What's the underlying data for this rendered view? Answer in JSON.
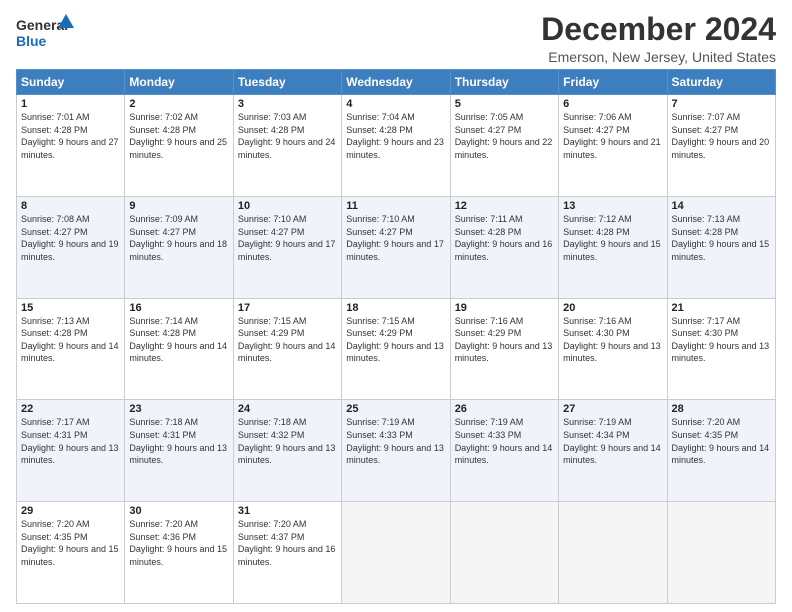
{
  "logo": {
    "line1": "General",
    "line2": "Blue"
  },
  "title": "December 2024",
  "subtitle": "Emerson, New Jersey, United States",
  "days_header": [
    "Sunday",
    "Monday",
    "Tuesday",
    "Wednesday",
    "Thursday",
    "Friday",
    "Saturday"
  ],
  "weeks": [
    [
      {
        "day": "1",
        "sunrise": "7:01 AM",
        "sunset": "4:28 PM",
        "daylight": "9 hours and 27 minutes."
      },
      {
        "day": "2",
        "sunrise": "7:02 AM",
        "sunset": "4:28 PM",
        "daylight": "9 hours and 25 minutes."
      },
      {
        "day": "3",
        "sunrise": "7:03 AM",
        "sunset": "4:28 PM",
        "daylight": "9 hours and 24 minutes."
      },
      {
        "day": "4",
        "sunrise": "7:04 AM",
        "sunset": "4:28 PM",
        "daylight": "9 hours and 23 minutes."
      },
      {
        "day": "5",
        "sunrise": "7:05 AM",
        "sunset": "4:27 PM",
        "daylight": "9 hours and 22 minutes."
      },
      {
        "day": "6",
        "sunrise": "7:06 AM",
        "sunset": "4:27 PM",
        "daylight": "9 hours and 21 minutes."
      },
      {
        "day": "7",
        "sunrise": "7:07 AM",
        "sunset": "4:27 PM",
        "daylight": "9 hours and 20 minutes."
      }
    ],
    [
      {
        "day": "8",
        "sunrise": "7:08 AM",
        "sunset": "4:27 PM",
        "daylight": "9 hours and 19 minutes."
      },
      {
        "day": "9",
        "sunrise": "7:09 AM",
        "sunset": "4:27 PM",
        "daylight": "9 hours and 18 minutes."
      },
      {
        "day": "10",
        "sunrise": "7:10 AM",
        "sunset": "4:27 PM",
        "daylight": "9 hours and 17 minutes."
      },
      {
        "day": "11",
        "sunrise": "7:10 AM",
        "sunset": "4:27 PM",
        "daylight": "9 hours and 17 minutes."
      },
      {
        "day": "12",
        "sunrise": "7:11 AM",
        "sunset": "4:28 PM",
        "daylight": "9 hours and 16 minutes."
      },
      {
        "day": "13",
        "sunrise": "7:12 AM",
        "sunset": "4:28 PM",
        "daylight": "9 hours and 15 minutes."
      },
      {
        "day": "14",
        "sunrise": "7:13 AM",
        "sunset": "4:28 PM",
        "daylight": "9 hours and 15 minutes."
      }
    ],
    [
      {
        "day": "15",
        "sunrise": "7:13 AM",
        "sunset": "4:28 PM",
        "daylight": "9 hours and 14 minutes."
      },
      {
        "day": "16",
        "sunrise": "7:14 AM",
        "sunset": "4:28 PM",
        "daylight": "9 hours and 14 minutes."
      },
      {
        "day": "17",
        "sunrise": "7:15 AM",
        "sunset": "4:29 PM",
        "daylight": "9 hours and 14 minutes."
      },
      {
        "day": "18",
        "sunrise": "7:15 AM",
        "sunset": "4:29 PM",
        "daylight": "9 hours and 13 minutes."
      },
      {
        "day": "19",
        "sunrise": "7:16 AM",
        "sunset": "4:29 PM",
        "daylight": "9 hours and 13 minutes."
      },
      {
        "day": "20",
        "sunrise": "7:16 AM",
        "sunset": "4:30 PM",
        "daylight": "9 hours and 13 minutes."
      },
      {
        "day": "21",
        "sunrise": "7:17 AM",
        "sunset": "4:30 PM",
        "daylight": "9 hours and 13 minutes."
      }
    ],
    [
      {
        "day": "22",
        "sunrise": "7:17 AM",
        "sunset": "4:31 PM",
        "daylight": "9 hours and 13 minutes."
      },
      {
        "day": "23",
        "sunrise": "7:18 AM",
        "sunset": "4:31 PM",
        "daylight": "9 hours and 13 minutes."
      },
      {
        "day": "24",
        "sunrise": "7:18 AM",
        "sunset": "4:32 PM",
        "daylight": "9 hours and 13 minutes."
      },
      {
        "day": "25",
        "sunrise": "7:19 AM",
        "sunset": "4:33 PM",
        "daylight": "9 hours and 13 minutes."
      },
      {
        "day": "26",
        "sunrise": "7:19 AM",
        "sunset": "4:33 PM",
        "daylight": "9 hours and 14 minutes."
      },
      {
        "day": "27",
        "sunrise": "7:19 AM",
        "sunset": "4:34 PM",
        "daylight": "9 hours and 14 minutes."
      },
      {
        "day": "28",
        "sunrise": "7:20 AM",
        "sunset": "4:35 PM",
        "daylight": "9 hours and 14 minutes."
      }
    ],
    [
      {
        "day": "29",
        "sunrise": "7:20 AM",
        "sunset": "4:35 PM",
        "daylight": "9 hours and 15 minutes."
      },
      {
        "day": "30",
        "sunrise": "7:20 AM",
        "sunset": "4:36 PM",
        "daylight": "9 hours and 15 minutes."
      },
      {
        "day": "31",
        "sunrise": "7:20 AM",
        "sunset": "4:37 PM",
        "daylight": "9 hours and 16 minutes."
      },
      null,
      null,
      null,
      null
    ]
  ]
}
